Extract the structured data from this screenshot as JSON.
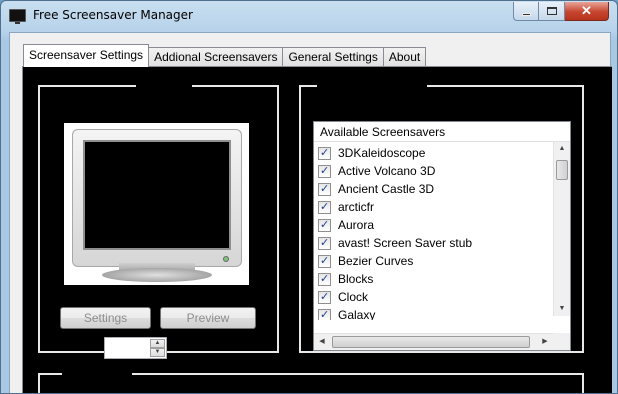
{
  "window": {
    "title": "Free Screensaver Manager",
    "caption_buttons": {
      "minimize": "minimize-icon",
      "maximize": "maximize-icon",
      "close": "close-icon",
      "close_glyph": "✕"
    }
  },
  "tabs": [
    {
      "label": "Screensaver Settings",
      "active": true
    },
    {
      "label": "Addional Screensavers",
      "active": false
    },
    {
      "label": "General Settings",
      "active": false
    },
    {
      "label": "About",
      "active": false
    }
  ],
  "preview": {
    "settings_label": "Settings",
    "preview_label": "Preview",
    "spinner_value": "",
    "spin_up": "▲",
    "spin_down": "▼"
  },
  "list": {
    "header": "Available Screensavers",
    "items": [
      {
        "label": "3DKaleidoscope",
        "checked": true
      },
      {
        "label": "Active Volcano 3D",
        "checked": true
      },
      {
        "label": "Ancient Castle 3D",
        "checked": true
      },
      {
        "label": "arcticfr",
        "checked": true
      },
      {
        "label": "Aurora",
        "checked": true
      },
      {
        "label": "avast! Screen Saver stub",
        "checked": true
      },
      {
        "label": "Bezier Curves",
        "checked": true
      },
      {
        "label": "Blocks",
        "checked": true
      },
      {
        "label": "Clock",
        "checked": true
      },
      {
        "label": "Galaxy",
        "checked": true
      }
    ],
    "scroll_up": "▲",
    "scroll_down": "▼",
    "scroll_left": "◀",
    "scroll_right": "▶"
  },
  "colors": {
    "panel_bg": "#000000",
    "frame_lines": "#e8e8e8",
    "check_color": "#1c3f8f",
    "close_red": "#c7452f"
  }
}
